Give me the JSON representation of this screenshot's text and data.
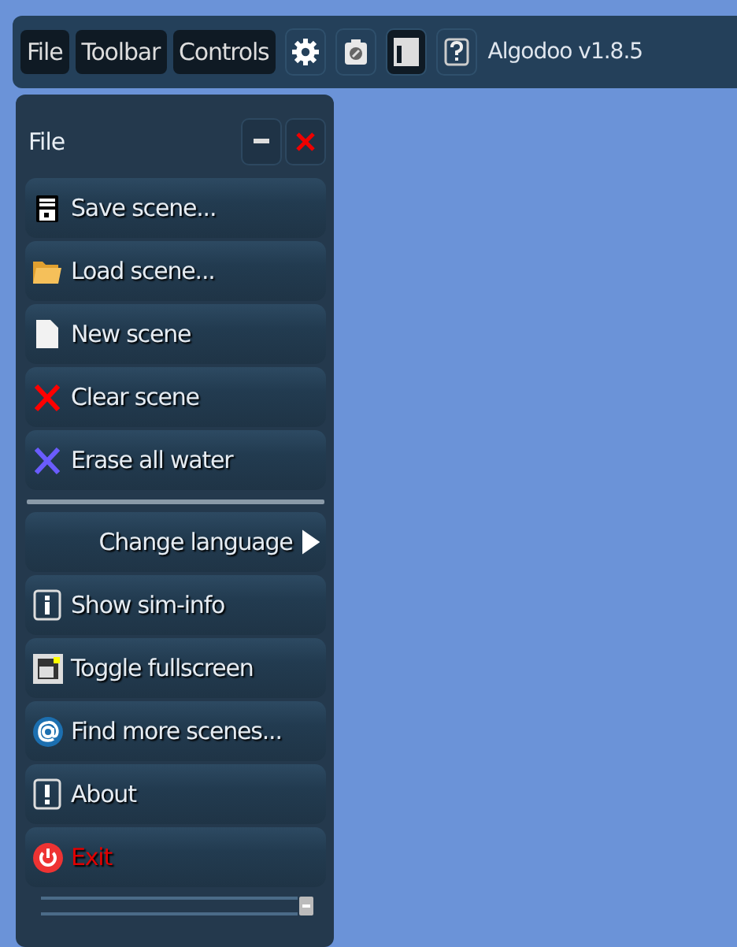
{
  "toolbar": {
    "menus": [
      {
        "label": "File",
        "selected": true
      },
      {
        "label": "Toolbar",
        "selected": true
      },
      {
        "label": "Controls",
        "selected": true
      }
    ],
    "tools": [
      {
        "selected": false
      },
      {
        "selected": false
      },
      {
        "selected": true
      },
      {
        "selected": false
      }
    ],
    "title": "Algodoo v1.8.5"
  },
  "panel": {
    "title": "File",
    "items": [
      {
        "kind": "item",
        "label": "Save scene...",
        "danger": false
      },
      {
        "kind": "item",
        "label": "Load scene...",
        "danger": false
      },
      {
        "kind": "item",
        "label": "New scene",
        "danger": false
      },
      {
        "kind": "item",
        "label": "Clear scene",
        "danger": false
      },
      {
        "kind": "item",
        "label": "Erase all water",
        "danger": false
      },
      {
        "kind": "separator"
      },
      {
        "kind": "submenu",
        "label": "Change language",
        "danger": false
      },
      {
        "kind": "item",
        "label": "Show sim-info",
        "danger": false
      },
      {
        "kind": "item",
        "label": "Toggle fullscreen",
        "danger": false
      },
      {
        "kind": "item",
        "label": "Find more scenes...",
        "danger": false
      },
      {
        "kind": "item",
        "label": "About",
        "danger": false
      },
      {
        "kind": "item",
        "label": "Exit",
        "danger": true
      }
    ]
  }
}
